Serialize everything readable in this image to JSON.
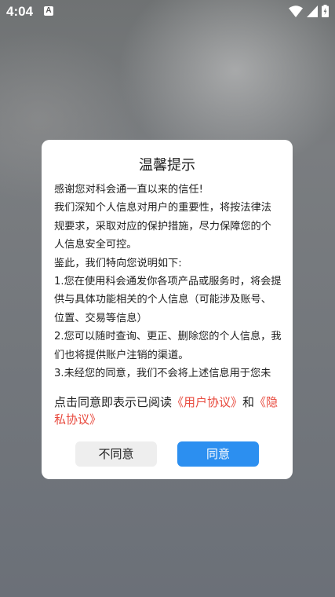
{
  "status_bar": {
    "time": "4:04",
    "notification_icon_label": "A"
  },
  "dialog": {
    "title": "温馨提示",
    "body": [
      "感谢您对科会通一直以来的信任!",
      "我们深知个人信息对用户的重要性，将按法律法规要求，采取对应的保护措施，尽力保障您的个人信息安全可控。",
      "鉴此，我们特向您说明如下:",
      "1.您在使用科会通发你各项产品或服务时，将会提供与具体功能相关的个人信息（可能涉及账号、位置、交易等信息）",
      "2.您可以随时查询、更正、删除您的个人信息，我们也将提供账户注销的渠道。",
      "3.未经您的同意，我们不会将上述信息用于您未"
    ],
    "agreement": {
      "prefix": "点击同意即表示已阅读",
      "user_agreement_link": "《用户协议》",
      "conjunction": "和",
      "privacy_link": "《隐私协议》"
    },
    "disagree_label": "不同意",
    "agree_label": "同意"
  },
  "colors": {
    "link": "#e8493d",
    "primary_button": "#2c8ff0",
    "secondary_button": "#eeeeee"
  }
}
